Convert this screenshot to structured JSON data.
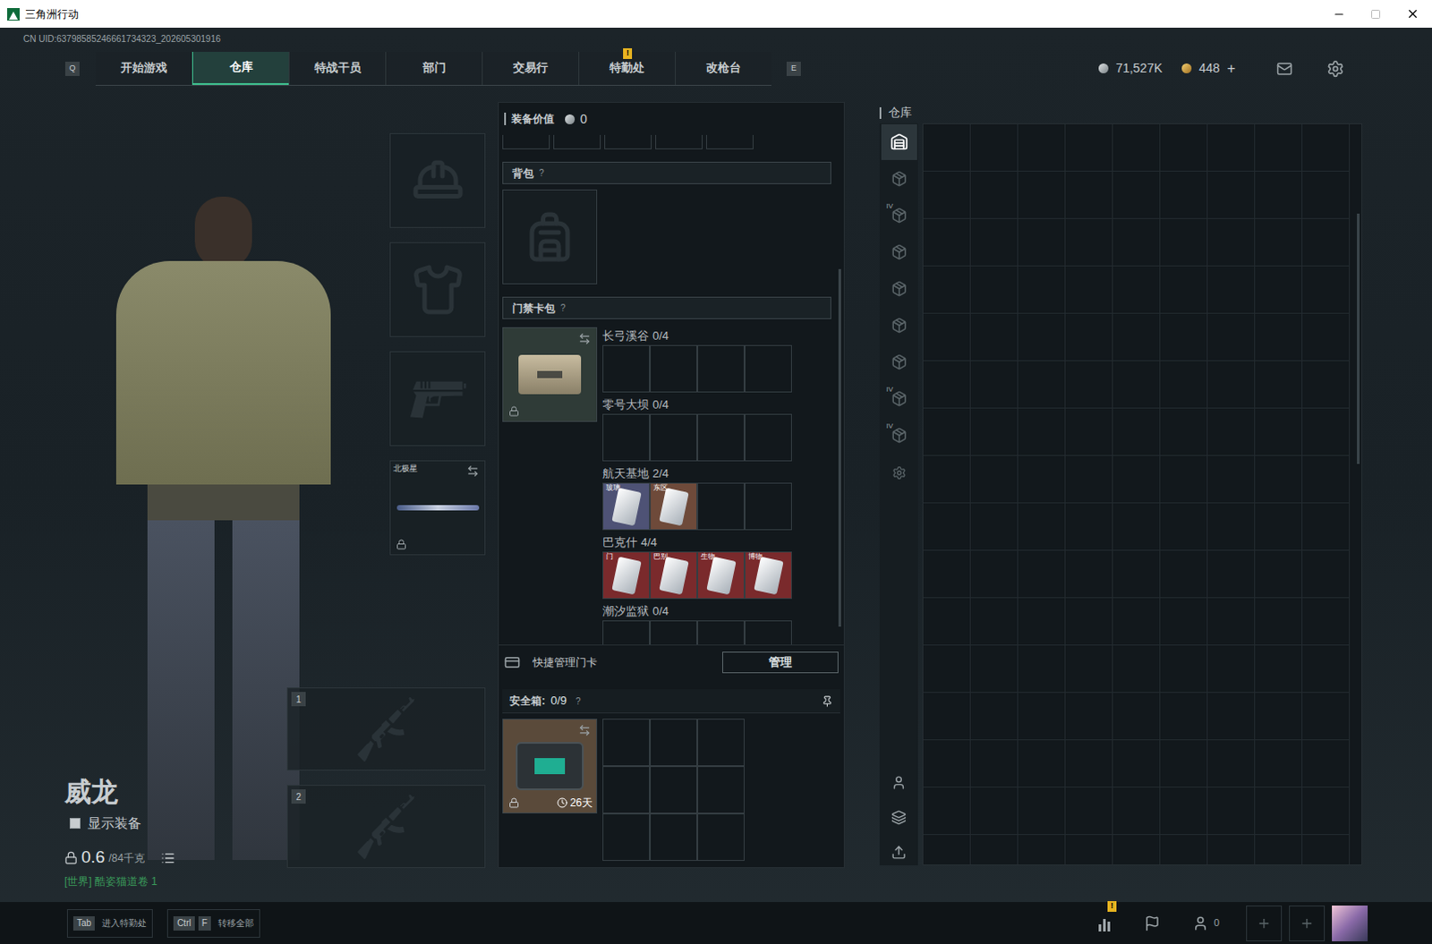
{
  "window": {
    "title": "三角洲行动"
  },
  "uid": "CN UID:63798585246661734323_202605301916",
  "nav": {
    "left_key": "Q",
    "right_key": "E",
    "tabs": [
      {
        "label": "开始游戏",
        "selected": false,
        "badge": ""
      },
      {
        "label": "仓库",
        "selected": true,
        "badge": ""
      },
      {
        "label": "特战干员",
        "selected": false,
        "badge": ""
      },
      {
        "label": "部门",
        "selected": false,
        "badge": ""
      },
      {
        "label": "交易行",
        "selected": false,
        "badge": ""
      },
      {
        "label": "特勤处",
        "selected": false,
        "badge": "!"
      },
      {
        "label": "改枪台",
        "selected": false,
        "badge": ""
      }
    ]
  },
  "currency": {
    "silver": "71,527K",
    "gold": "448",
    "add": "+"
  },
  "operator": {
    "name": "威龙",
    "show_equipment": {
      "label": "显示装备",
      "checked": false
    },
    "weight": "0.6",
    "weight_max": "/84千克",
    "chat": "[世界] 酷姿猫道卷 1"
  },
  "equipment": {
    "slots": [
      {
        "kind": "helmet",
        "label": "",
        "locked": false
      },
      {
        "kind": "armor",
        "label": "",
        "locked": false
      },
      {
        "kind": "pistol",
        "label": "",
        "locked": false
      },
      {
        "kind": "melee",
        "label": "北极星",
        "locked": true
      }
    ],
    "weapons": [
      {
        "number": "1"
      },
      {
        "number": "2"
      }
    ]
  },
  "loadout": {
    "value_label": "装备价值",
    "value": "0",
    "backpack": {
      "title": "背包",
      "help": "?"
    },
    "keycard_case": {
      "title": "门禁卡包",
      "help": "?",
      "locked": true,
      "maps": [
        {
          "name": "长弓溪谷",
          "count": "0/4",
          "cards": []
        },
        {
          "name": "零号大坝",
          "count": "0/4",
          "cards": []
        },
        {
          "name": "航天基地",
          "count": "2/4",
          "cards": [
            {
              "label": "玻璃",
              "color": "#4e5275"
            },
            {
              "label": "东区",
              "color": "#6e4a3a"
            }
          ]
        },
        {
          "name": "巴克什",
          "count": "4/4",
          "cards": [
            {
              "label": "门",
              "color": "#7a2a2c"
            },
            {
              "label": "巴别",
              "color": "#7a2a2c"
            },
            {
              "label": "生物",
              "color": "#7a2a2c"
            },
            {
              "label": "博物",
              "color": "#7a2a2c"
            }
          ]
        },
        {
          "name": "潮汐监狱",
          "count": "0/4",
          "cards": []
        }
      ]
    },
    "quick_manage": {
      "label": "快捷管理门卡",
      "button": "管理"
    },
    "safebox": {
      "title": "安全箱:",
      "count": "0/9",
      "help": "?",
      "timer": "26天",
      "locked": true
    }
  },
  "warehouse": {
    "title": "仓库",
    "sidebar": [
      {
        "label": "",
        "selected": true
      },
      {
        "label": "",
        "selected": false
      },
      {
        "label": "IV",
        "selected": false
      },
      {
        "label": "",
        "selected": false
      },
      {
        "label": "",
        "selected": false
      },
      {
        "label": "",
        "selected": false
      },
      {
        "label": "",
        "selected": false
      },
      {
        "label": "IV",
        "selected": false
      },
      {
        "label": "IV",
        "selected": false
      }
    ]
  },
  "bottom_bar": {
    "hints": [
      {
        "keys": [
          "Tab"
        ],
        "label": "进入特勤处"
      },
      {
        "keys": [
          "Ctrl",
          "F"
        ],
        "label": "转移全部"
      }
    ],
    "stats_badge": "!",
    "friends": "0"
  }
}
